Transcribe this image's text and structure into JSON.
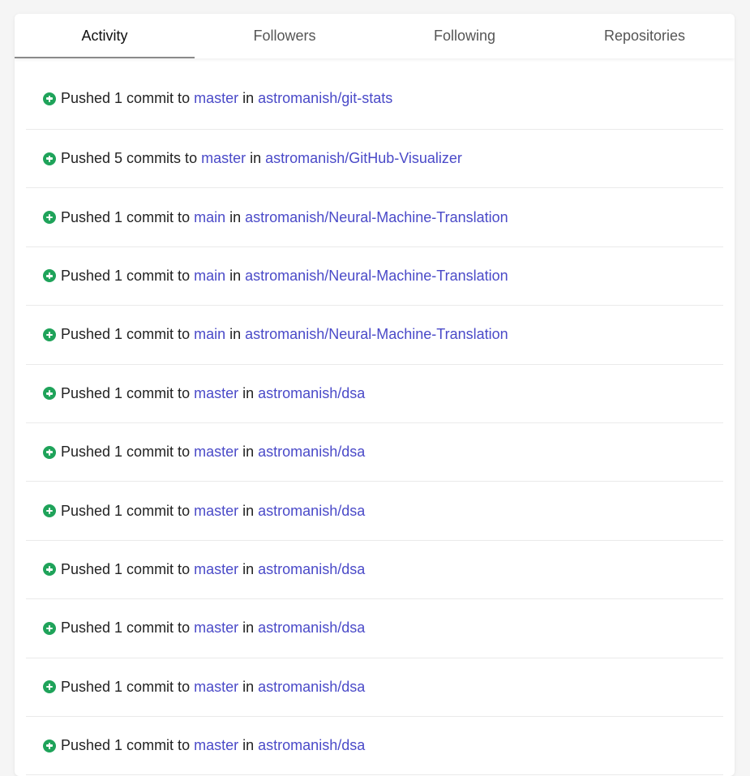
{
  "tabs": [
    {
      "label": "Activity",
      "active": true
    },
    {
      "label": "Followers",
      "active": false
    },
    {
      "label": "Following",
      "active": false
    },
    {
      "label": "Repositories",
      "active": false
    }
  ],
  "feed": {
    "in_word": "in",
    "items": [
      {
        "action": "Pushed 1 commit to",
        "branch": "master",
        "repo": "astromanish/git-stats"
      },
      {
        "action": "Pushed 5 commits to",
        "branch": "master",
        "repo": "astromanish/GitHub-Visualizer"
      },
      {
        "action": "Pushed 1 commit to",
        "branch": "main",
        "repo": "astromanish/Neural-Machine-Translation"
      },
      {
        "action": "Pushed 1 commit to",
        "branch": "main",
        "repo": "astromanish/Neural-Machine-Translation"
      },
      {
        "action": "Pushed 1 commit to",
        "branch": "main",
        "repo": "astromanish/Neural-Machine-Translation"
      },
      {
        "action": "Pushed 1 commit to",
        "branch": "master",
        "repo": "astromanish/dsa"
      },
      {
        "action": "Pushed 1 commit to",
        "branch": "master",
        "repo": "astromanish/dsa"
      },
      {
        "action": "Pushed 1 commit to",
        "branch": "master",
        "repo": "astromanish/dsa"
      },
      {
        "action": "Pushed 1 commit to",
        "branch": "master",
        "repo": "astromanish/dsa"
      },
      {
        "action": "Pushed 1 commit to",
        "branch": "master",
        "repo": "astromanish/dsa"
      },
      {
        "action": "Pushed 1 commit to",
        "branch": "master",
        "repo": "astromanish/dsa"
      },
      {
        "action": "Pushed 1 commit to",
        "branch": "master",
        "repo": "astromanish/dsa"
      }
    ]
  },
  "colors": {
    "link": "#4a4ac8",
    "icon": "#1fa35a",
    "tab_underline": "#8a8a8a"
  },
  "icons": {
    "feed_item": "plus-circle-icon"
  }
}
